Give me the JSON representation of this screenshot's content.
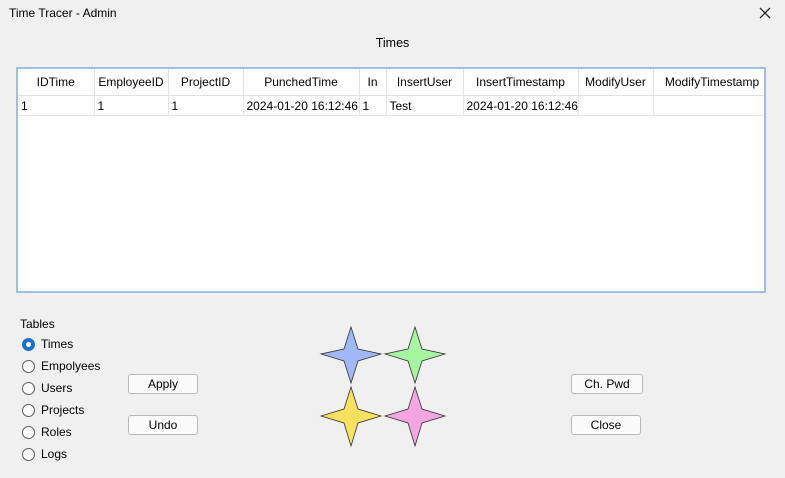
{
  "window": {
    "title": "Time Tracer - Admin"
  },
  "section_title": "Times",
  "grid": {
    "columns": [
      "IDTime",
      "EmployeeID",
      "ProjectID",
      "PunchedTime",
      "In",
      "InsertUser",
      "InsertTimestamp",
      "ModifyUser",
      "ModifyTimestamp"
    ],
    "rows": [
      [
        "1",
        "1",
        "1",
        "2024-01-20 16:12:46",
        "1",
        "Test",
        "2024-01-20 16:12:46",
        "",
        ""
      ]
    ]
  },
  "tables": {
    "label": "Tables",
    "options": [
      "Times",
      "Empolyees",
      "Users",
      "Projects",
      "Roles",
      "Logs"
    ],
    "selected": "Times"
  },
  "buttons": {
    "apply": "Apply",
    "undo": "Undo",
    "change_password": "Ch. Pwd",
    "close": "Close"
  },
  "logo_colors": {
    "top_left": "#a0b8f8",
    "top_right": "#a6f5a0",
    "bottom_left": "#f8e060",
    "bottom_right": "#f4a6e2"
  },
  "icons": {
    "close": "close-icon",
    "logo": "stars-logo"
  }
}
